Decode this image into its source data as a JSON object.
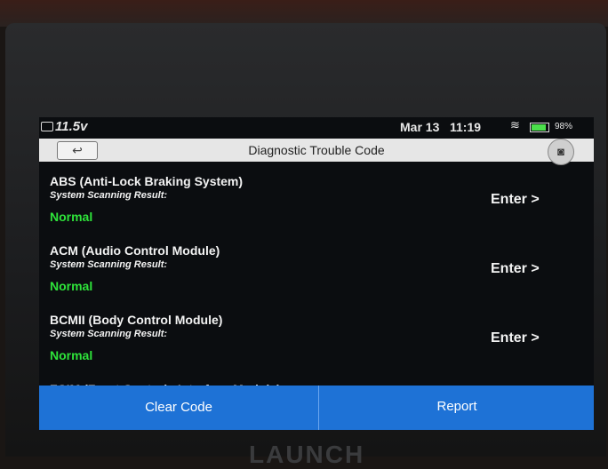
{
  "status_bar": {
    "battery_voltage": "11.5v",
    "date": "Mar 13",
    "time": "11:19",
    "wifi_icon": "wifi-icon",
    "battery_percent": "98%"
  },
  "title_bar": {
    "back_icon": "↩",
    "title": "Diagnostic Trouble Code",
    "camera_icon": "📷"
  },
  "modules": [
    {
      "name": "ABS (Anti-Lock Braking System)",
      "scan_label": "System Scanning Result:",
      "status": "Normal",
      "enter": "Enter >"
    },
    {
      "name": "ACM (Audio Control Module)",
      "scan_label": "System Scanning Result:",
      "status": "Normal",
      "enter": "Enter >"
    },
    {
      "name": "BCMII (Body Control Module)",
      "scan_label": "System Scanning Result:",
      "status": "Normal",
      "enter": "Enter >"
    }
  ],
  "partial_module": "FCIM (Front Controls Interface Module)",
  "actions": {
    "clear_code": "Clear Code",
    "report": "Report"
  },
  "brand": "LAUNCH",
  "colors": {
    "status_normal": "#2ee33a",
    "action_bar": "#1e72d6",
    "title_bar": "#e6e6e6"
  }
}
